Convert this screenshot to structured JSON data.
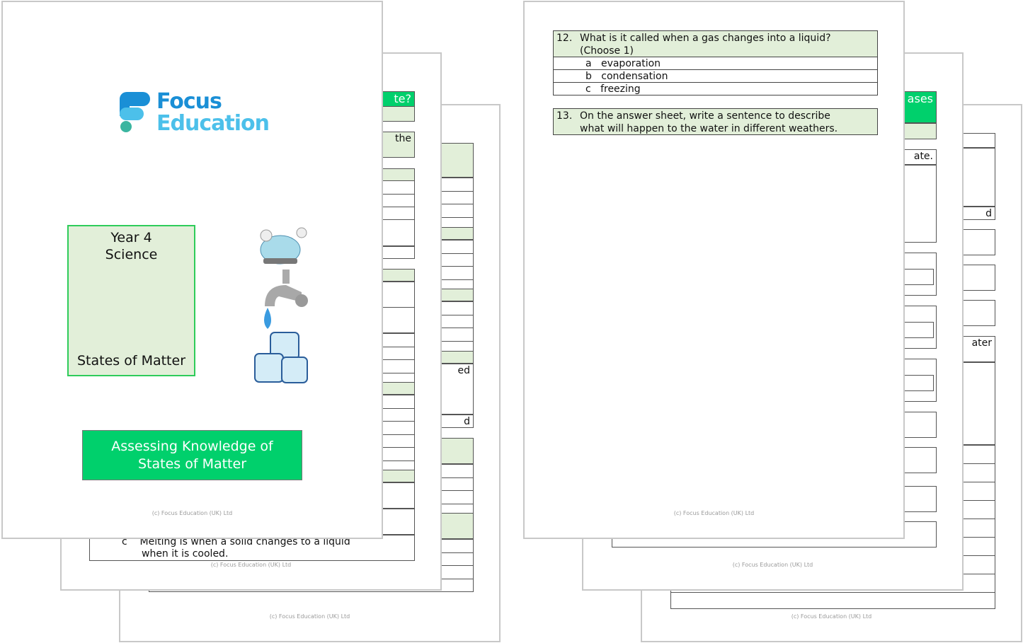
{
  "footer_text": "(c) Focus Education (UK) Ltd",
  "colors": {
    "green_header": "#00d06c",
    "light_green": "#e2efd9",
    "logo_dark_blue": "#1a8fd6",
    "logo_light_blue": "#4cc0ea",
    "logo_teal": "#3ab5a0"
  },
  "cover": {
    "logo": {
      "line1": "Focus",
      "line2": "Education"
    },
    "year": "Year 4",
    "subject": "Science",
    "topic": "States of Matter",
    "banner": {
      "line1": "Assessing Knowledge of",
      "line2": "States of Matter"
    },
    "images": [
      "kettle-steam",
      "dripping-tap",
      "ice-cubes"
    ]
  },
  "left_page2_fragments": {
    "header": "te?",
    "text1": "the",
    "question_c_letter": "c",
    "question_c_line1": "Melting is when a solid changes to a liquid",
    "question_c_line2": "when it is cooled."
  },
  "left_page3_fragments": {
    "text1": "ed",
    "text2": "d"
  },
  "right_front": {
    "q12": {
      "number": "12.",
      "text1": "What is it called when a gas changes into a liquid?",
      "text2": "(Choose 1)",
      "options": [
        {
          "letter": "a",
          "text": "evaporation"
        },
        {
          "letter": "b",
          "text": "condensation"
        },
        {
          "letter": "c",
          "text": "freezing"
        }
      ]
    },
    "q13": {
      "number": "13.",
      "text1": "On the answer sheet, write a sentence to describe",
      "text2": "what will happen to the water in different weathers."
    }
  },
  "right_page2_fragments": {
    "header": "ases",
    "text1": "ate."
  },
  "right_page3_fragments": {
    "text1": "d",
    "text2": "ater"
  }
}
